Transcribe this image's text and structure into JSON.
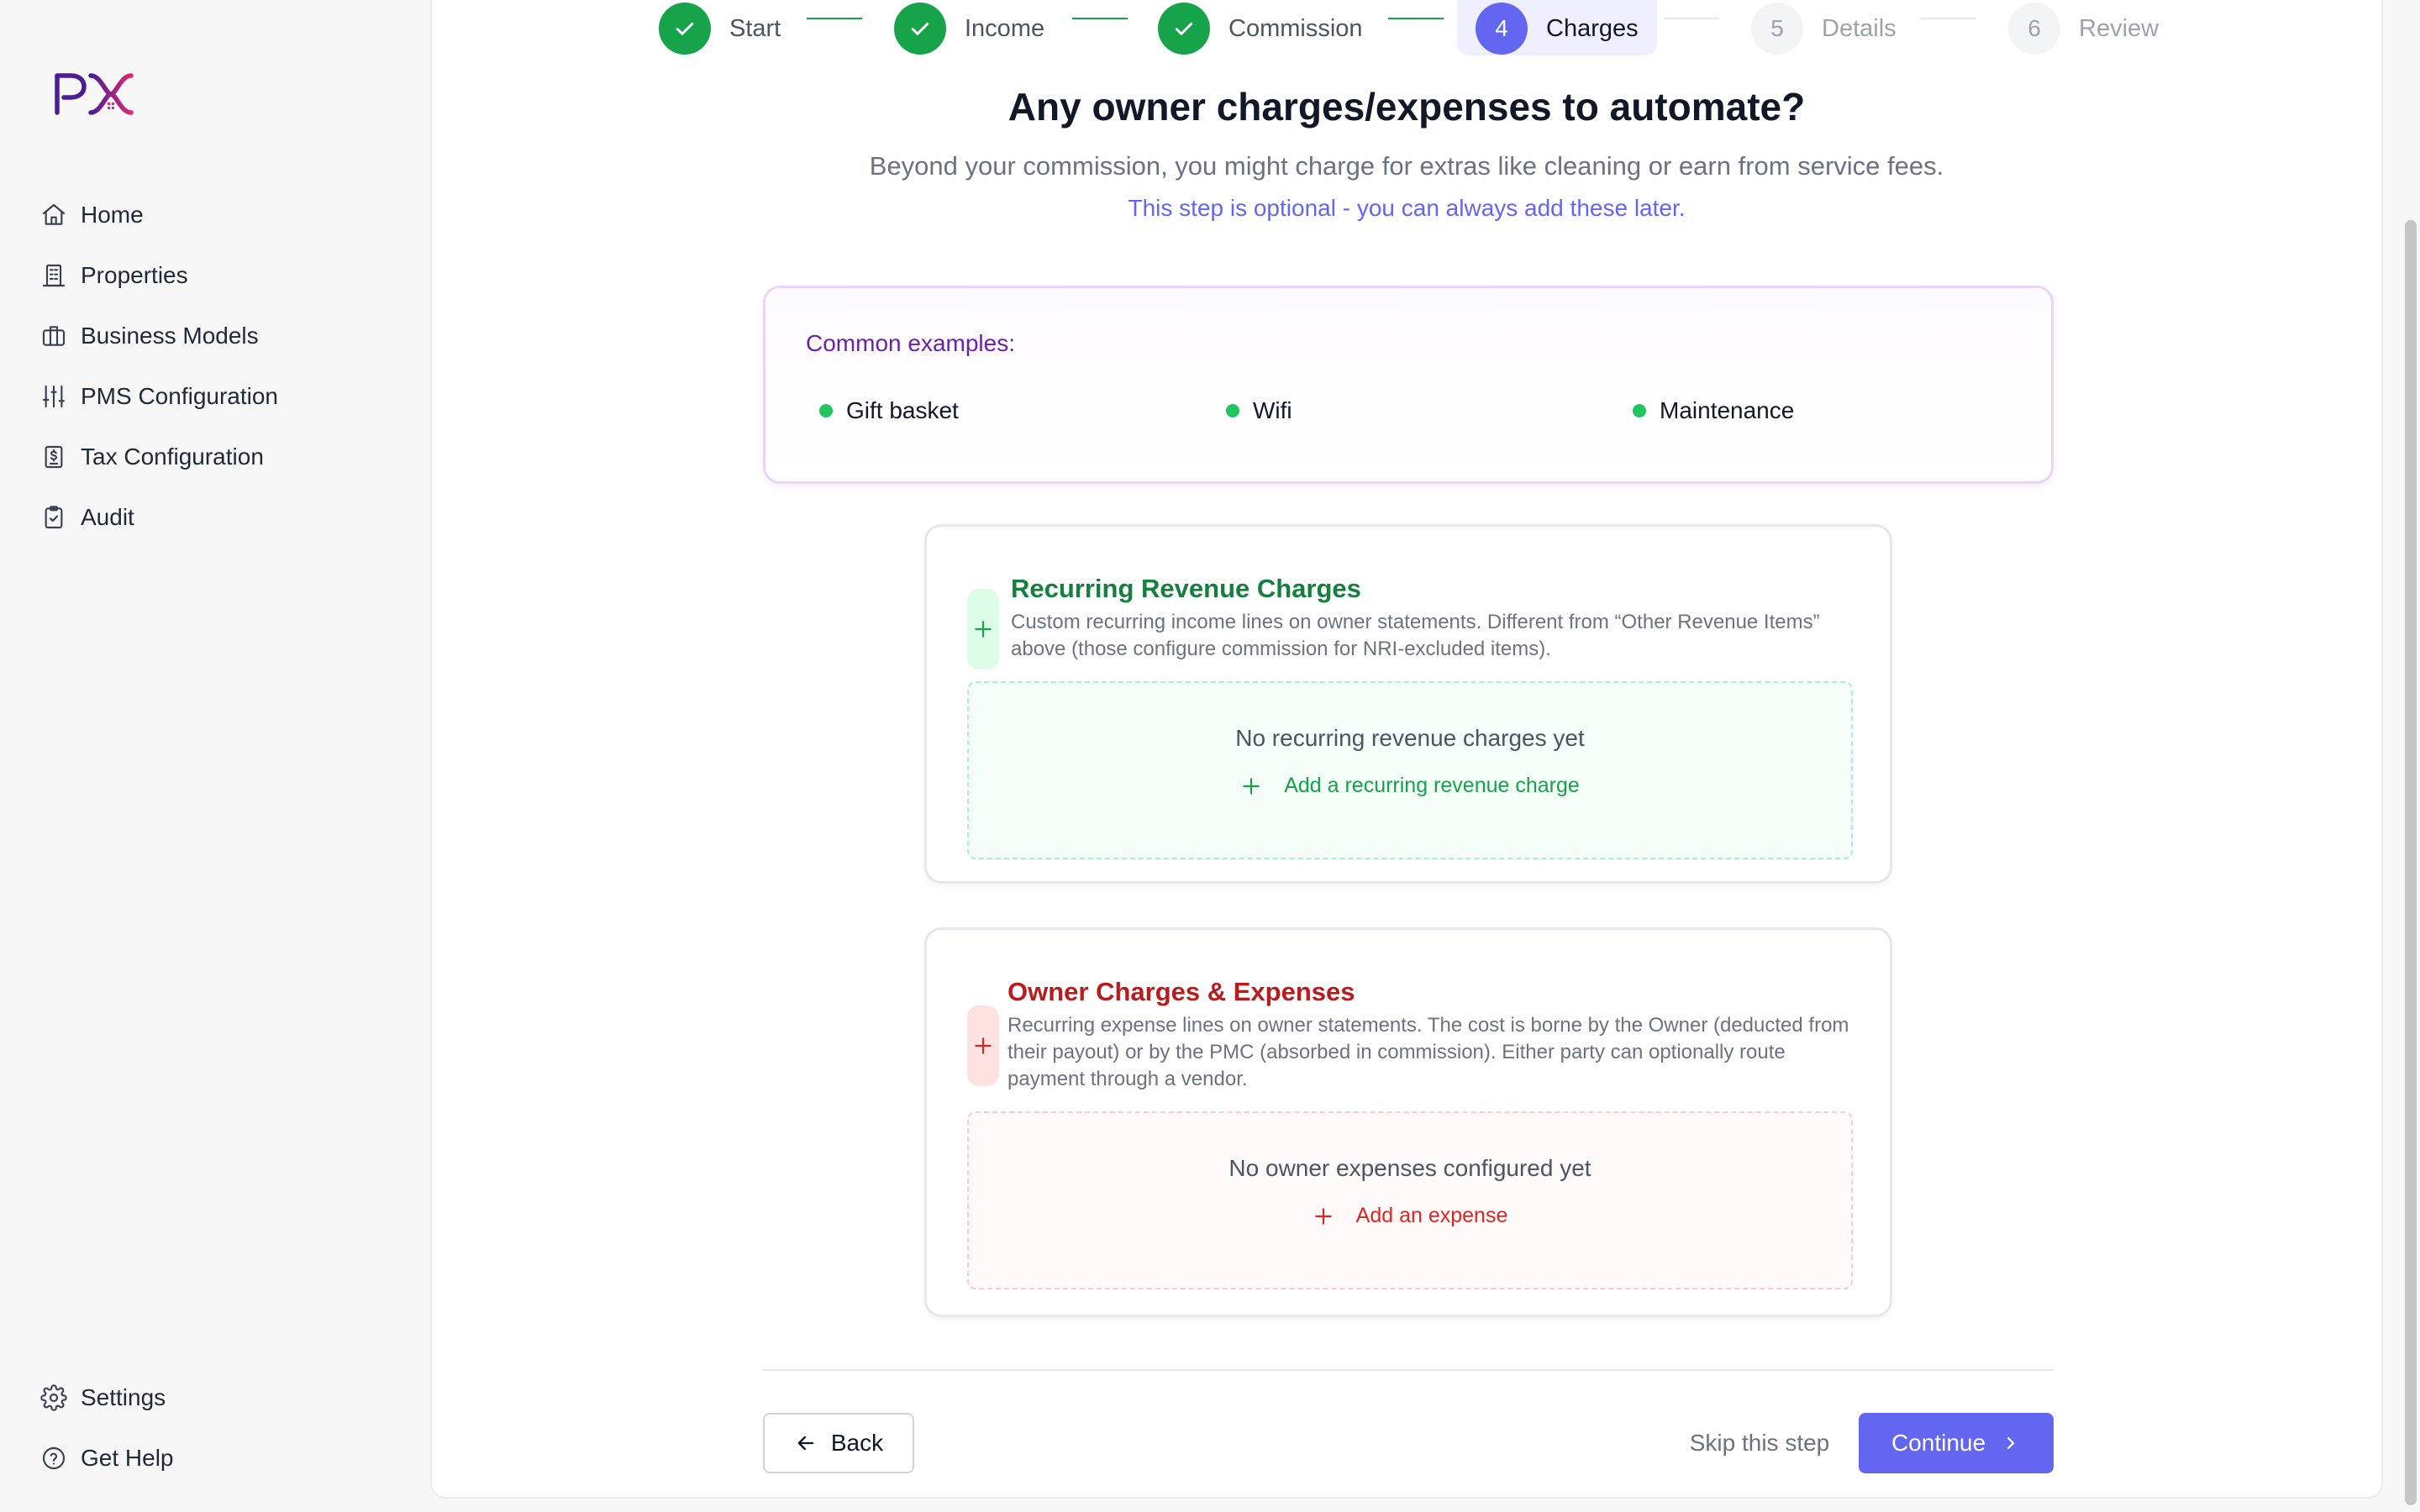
{
  "brand": {
    "logo_text": "PX"
  },
  "sidebar": {
    "items": [
      {
        "label": "Home",
        "icon": "home-icon"
      },
      {
        "label": "Properties",
        "icon": "building-icon"
      },
      {
        "label": "Business Models",
        "icon": "briefcase-icon"
      },
      {
        "label": "PMS Configuration",
        "icon": "sliders-icon"
      },
      {
        "label": "Tax Configuration",
        "icon": "receipt-icon"
      },
      {
        "label": "Audit",
        "icon": "clipboard-check-icon"
      }
    ],
    "bottom_items": [
      {
        "label": "Settings",
        "icon": "gear-icon"
      },
      {
        "label": "Get Help",
        "icon": "help-circle-icon"
      }
    ]
  },
  "stepper": {
    "steps": [
      {
        "label": "Start",
        "state": "done"
      },
      {
        "label": "Income",
        "state": "done"
      },
      {
        "label": "Commission",
        "state": "done"
      },
      {
        "number": "4",
        "label": "Charges",
        "state": "current"
      },
      {
        "number": "5",
        "label": "Details",
        "state": "todo"
      },
      {
        "number": "6",
        "label": "Review",
        "state": "todo"
      }
    ]
  },
  "main": {
    "title": "Any owner charges/expenses to automate?",
    "subtitle": "Beyond your commission, you might charge for extras like cleaning or earn from service fees.",
    "optional_note": "This step is optional - you can always add these later.",
    "examples": {
      "title": "Common examples:",
      "items": [
        "Gift basket",
        "Wifi",
        "Maintenance"
      ]
    },
    "revenue_section": {
      "title": "Recurring Revenue Charges",
      "description": "Custom recurring income lines on owner statements. Different from “Other Revenue Items” above (those configure commission for NRI-excluded items).",
      "empty_text": "No recurring revenue charges yet",
      "add_label": "Add a recurring revenue charge"
    },
    "expense_section": {
      "title": "Owner Charges & Expenses",
      "description": "Recurring expense lines on owner statements. The cost is borne by the Owner (deducted from their payout) or by the PMC (absorbed in commission). Either party can optionally route payment through a vendor.",
      "empty_text": "No owner expenses configured yet",
      "add_label": "Add an expense"
    }
  },
  "footer": {
    "back_label": "Back",
    "skip_label": "Skip this step",
    "continue_label": "Continue"
  },
  "colors": {
    "accent": "#6366f1",
    "success": "#16a34a",
    "danger": "#dc2626",
    "examples_title": "#6b21a8"
  }
}
